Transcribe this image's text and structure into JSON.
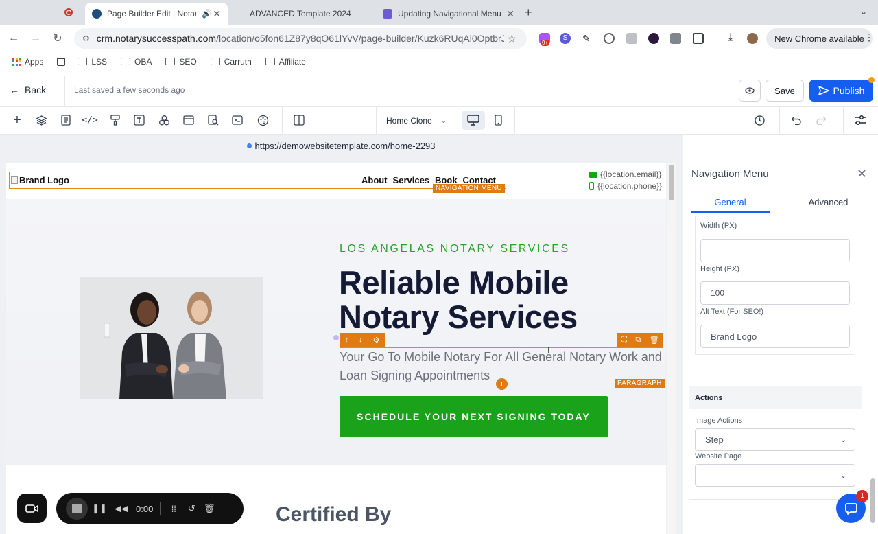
{
  "browser": {
    "tabs": [
      {
        "title": "Page Builder Edit | Notary",
        "active": true
      },
      {
        "title": "ADVANCED Template 2024",
        "active": false
      },
      {
        "title": "Updating Navigational Menu",
        "active": false
      }
    ],
    "url_host": "crm.notarysuccesspath.com",
    "url_path": "/location/o5fon61Z87y8qO61lYvV/page-builder/Kuzk6RUqAl0OptbrJF...",
    "new_chrome_label": "New Chrome available",
    "ext_badge": "9+",
    "bookmarks": [
      "Apps",
      "LSS",
      "OBA",
      "SEO",
      "Carruth",
      "Affiliate"
    ]
  },
  "builder": {
    "back_label": "Back",
    "last_saved": "Last saved a few seconds ago",
    "save_label": "Save",
    "publish_label": "Publish",
    "page_select": "Home Clone",
    "preview_url": "https://demowebsitetemplate.com/home-2293"
  },
  "site": {
    "brand_logo_alt": "Brand Logo",
    "nav": [
      "About",
      "Services",
      "Book",
      "Contact"
    ],
    "nav_tag": "NAVIGATION MENU",
    "email": "{{location.email}}",
    "phone": "{{location.phone}}",
    "eyebrow": "LOS ANGELAS NOTARY SERVICES",
    "headline_1": "Reliable Mobile",
    "headline_2": "Notary Services",
    "paragraph": "Your Go To Mobile Notary For All General Notary Work and Loan Signing Appointments",
    "paragraph_tag": "PARAGRAPH",
    "cta": "SCHEDULE YOUR NEXT SIGNING TODAY",
    "next_section": "Certified By"
  },
  "recorder": {
    "time": "0:00"
  },
  "panel": {
    "title": "Navigation Menu",
    "tab_general": "General",
    "tab_advanced": "Advanced",
    "width_label": "Width (PX)",
    "width_value": "",
    "height_label": "Height (PX)",
    "height_value": "100",
    "alt_label": "Alt Text (For SEO!)",
    "alt_value": "Brand Logo",
    "actions_header": "Actions",
    "image_actions_label": "Image Actions",
    "image_actions_value": "Step",
    "website_page_label": "Website Page",
    "website_page_value": "",
    "chat_badge": "1"
  },
  "colors": {
    "accent": "#155eef",
    "selection": "#e07a12",
    "cta_green": "#1aa31a",
    "headline": "#151a35"
  }
}
